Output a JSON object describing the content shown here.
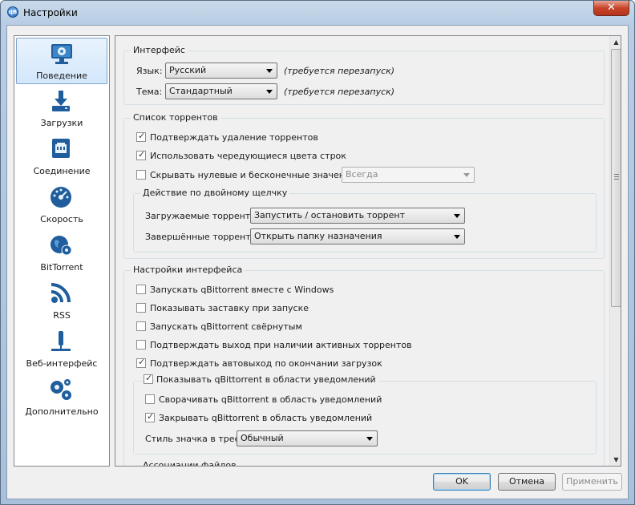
{
  "window": {
    "title": "Настройки",
    "app_icon_label": "qB",
    "close_label": "✕"
  },
  "sidebar": {
    "items": [
      {
        "label": "Поведение",
        "icon": "monitor-gear-icon",
        "selected": true
      },
      {
        "label": "Загрузки",
        "icon": "download-icon",
        "selected": false
      },
      {
        "label": "Соединение",
        "icon": "network-port-icon",
        "selected": false
      },
      {
        "label": "Скорость",
        "icon": "speedometer-icon",
        "selected": false
      },
      {
        "label": "BitTorrent",
        "icon": "globe-gear-icon",
        "selected": false
      },
      {
        "label": "RSS",
        "icon": "rss-icon",
        "selected": false
      },
      {
        "label": "Веб-интерфейс",
        "icon": "web-ui-icon",
        "selected": false
      },
      {
        "label": "Дополнительно",
        "icon": "gears-icon",
        "selected": false
      }
    ]
  },
  "interface": {
    "title": "Интерфейс",
    "language_label": "Язык:",
    "language_value": "Русский",
    "theme_label": "Тема:",
    "theme_value": "Стандартный",
    "restart_hint": "(требуется перезапуск)"
  },
  "torrent_list": {
    "title": "Список торрентов",
    "confirm_delete": {
      "label": "Подтверждать удаление торрентов",
      "checked": true
    },
    "alt_row_colors": {
      "label": "Использовать чередующиеся цвета строк",
      "checked": true
    },
    "hide_zero": {
      "label": "Скрывать нулевые и бесконечные значения",
      "checked": false,
      "combo_value": "Всегда"
    },
    "double_click": {
      "title": "Действие по двойному щелчку",
      "downloading_label": "Загружаемые торренты:",
      "downloading_value": "Запустить / остановить торрент",
      "completed_label": "Завершённые торренты:",
      "completed_value": "Открыть папку назначения"
    }
  },
  "ui_settings": {
    "title": "Настройки интерфейса",
    "start_with_windows": {
      "label": "Запускать qBittorrent вместе с Windows",
      "checked": false
    },
    "show_splash": {
      "label": "Показывать заставку при запуске",
      "checked": false
    },
    "start_minimized": {
      "label": "Запускать qBittorrent свёрнутым",
      "checked": false
    },
    "confirm_exit": {
      "label": "Подтверждать выход при наличии активных торрентов",
      "checked": false
    },
    "confirm_auto_exit": {
      "label": "Подтверждать автовыход по окончании загрузок",
      "checked": true
    },
    "tray": {
      "label": "Показывать qBittorrent в области уведомлений",
      "checked": true,
      "minimize_to_tray": {
        "label": "Сворачивать qBittorrent в область уведомлений",
        "checked": false
      },
      "close_to_tray": {
        "label": "Закрывать qBittorrent в область уведомлений",
        "checked": true
      },
      "icon_style_label": "Стиль значка в трее:",
      "icon_style_value": "Обычный"
    }
  },
  "file_assoc": {
    "title": "Ассоциации файлов"
  },
  "buttons": {
    "ok": "OK",
    "cancel": "Отмена",
    "apply": "Применить"
  }
}
